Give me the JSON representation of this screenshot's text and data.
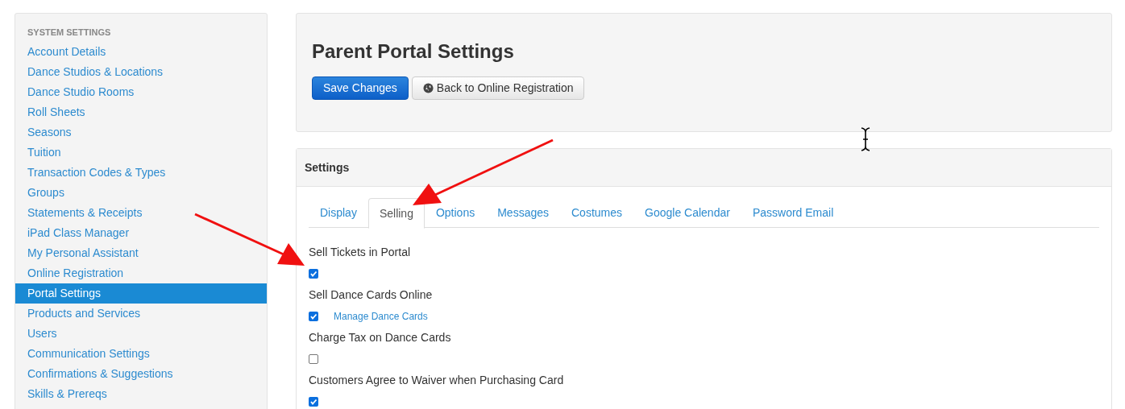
{
  "sidebar": {
    "heading": "SYSTEM SETTINGS",
    "items": [
      {
        "label": "Account Details",
        "selected": false
      },
      {
        "label": "Dance Studios & Locations",
        "selected": false
      },
      {
        "label": "Dance Studio Rooms",
        "selected": false
      },
      {
        "label": "Roll Sheets",
        "selected": false
      },
      {
        "label": "Seasons",
        "selected": false
      },
      {
        "label": "Tuition",
        "selected": false
      },
      {
        "label": "Transaction Codes & Types",
        "selected": false
      },
      {
        "label": "Groups",
        "selected": false
      },
      {
        "label": "Statements & Receipts",
        "selected": false
      },
      {
        "label": "iPad Class Manager",
        "selected": false
      },
      {
        "label": "My Personal Assistant",
        "selected": false
      },
      {
        "label": "Online Registration",
        "selected": false
      },
      {
        "label": "Portal Settings",
        "selected": true
      },
      {
        "label": "Products and Services",
        "selected": false
      },
      {
        "label": "Users",
        "selected": false
      },
      {
        "label": "Communication Settings",
        "selected": false
      },
      {
        "label": "Confirmations & Suggestions",
        "selected": false
      },
      {
        "label": "Skills & Prereqs",
        "selected": false
      }
    ]
  },
  "header": {
    "title": "Parent Portal Settings",
    "save_button": "Save Changes",
    "back_button": "Back to Online Registration"
  },
  "settings": {
    "title": "Settings",
    "tabs": [
      {
        "label": "Display",
        "selected": false
      },
      {
        "label": "Selling",
        "selected": true
      },
      {
        "label": "Options",
        "selected": false
      },
      {
        "label": "Messages",
        "selected": false
      },
      {
        "label": "Costumes",
        "selected": false
      },
      {
        "label": "Google Calendar",
        "selected": false
      },
      {
        "label": "Password Email",
        "selected": false
      }
    ],
    "options": [
      {
        "label": "Sell Tickets in Portal",
        "checked": true
      },
      {
        "label": "Sell Dance Cards Online",
        "checked": true,
        "link": "Manage Dance Cards"
      },
      {
        "label": "Charge Tax on Dance Cards",
        "checked": false
      },
      {
        "label": "Customers Agree to Waiver when Purchasing Card",
        "checked": true
      }
    ]
  }
}
